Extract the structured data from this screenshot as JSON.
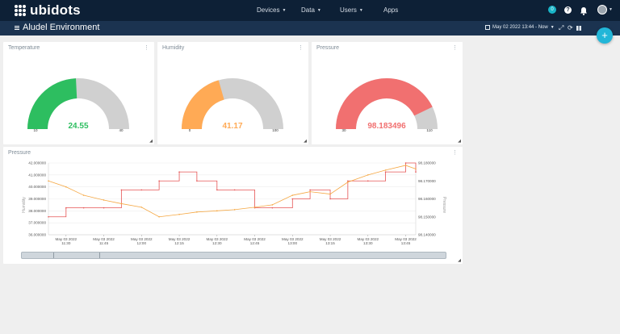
{
  "topbar": {
    "logo_text": "ubidots",
    "nav": [
      {
        "label": "Devices",
        "has_caret": true
      },
      {
        "label": "Data",
        "has_caret": true
      },
      {
        "label": "Users",
        "has_caret": true
      },
      {
        "label": "Apps",
        "has_caret": false
      }
    ],
    "badge_count": "0",
    "help_glyph": "?",
    "icons": [
      "bell-icon",
      "user-avatar"
    ]
  },
  "subbar": {
    "title": "Aludel Environment",
    "date_range": "May 02 2022 13:44 - Now",
    "icons": [
      "calendar-icon",
      "expand-icon",
      "refresh-icon",
      "columns-icon"
    ]
  },
  "fab_label": "+",
  "widgets": {
    "temperature": {
      "title": "Temperature",
      "value": "24.55",
      "min": "10",
      "max": "40",
      "fraction": 0.485,
      "color": "#2dbe60"
    },
    "humidity": {
      "title": "Humidity",
      "value": "41.17",
      "min": "0",
      "max": "100",
      "fraction": 0.4117,
      "color": "#ffaa55"
    },
    "pressure": {
      "title": "Pressure",
      "value": "98.183496",
      "min": "30",
      "max": "110",
      "fraction": 0.856,
      "color": "#f17070"
    }
  },
  "chart": {
    "title": "Pressure",
    "left_axis_label": "Humidity",
    "right_axis_label": "Pressure",
    "left_ticks": [
      "42.000000",
      "41.000000",
      "40.000000",
      "39.000000",
      "38.000000",
      "37.000000",
      "36.000000"
    ],
    "right_ticks": [
      "98.180000",
      "98.170000",
      "98.160000",
      "98.150000",
      "98.140000"
    ],
    "x_ticks": [
      {
        "date": "May 03 2022",
        "time": "11:30"
      },
      {
        "date": "May 03 2022",
        "time": "11:45"
      },
      {
        "date": "May 03 2022",
        "time": "12:00"
      },
      {
        "date": "May 03 2022",
        "time": "12:15"
      },
      {
        "date": "May 03 2022",
        "time": "12:30"
      },
      {
        "date": "May 03 2022",
        "time": "12:45"
      },
      {
        "date": "May 03 2022",
        "time": "13:00"
      },
      {
        "date": "May 03 2022",
        "time": "13:15"
      },
      {
        "date": "May 03 2022",
        "time": "13:30"
      },
      {
        "date": "May 03 2022",
        "time": "13:45"
      }
    ],
    "humidity_color": "#f5a742",
    "pressure_color": "#e55353"
  },
  "chart_data": {
    "type": "line",
    "title": "Pressure",
    "xlabel": "",
    "ylabel": "Humidity",
    "y2label": "Pressure",
    "ylim": [
      36,
      42
    ],
    "y2lim": [
      98.14,
      98.18
    ],
    "series": [
      {
        "name": "Humidity",
        "axis": "left",
        "x": [
          "11:23",
          "11:30",
          "11:37",
          "11:45",
          "11:52",
          "12:00",
          "12:07",
          "12:15",
          "12:22",
          "12:30",
          "12:37",
          "12:45",
          "12:52",
          "13:00",
          "13:07",
          "13:15",
          "13:22",
          "13:30",
          "13:37",
          "13:45",
          "13:49"
        ],
        "values": [
          40.5,
          40.0,
          39.3,
          38.9,
          38.6,
          38.3,
          37.5,
          37.7,
          37.9,
          38.0,
          38.1,
          38.3,
          38.5,
          39.3,
          39.6,
          39.4,
          40.4,
          41.0,
          41.4,
          41.8,
          41.5
        ]
      },
      {
        "name": "Pressure",
        "axis": "right",
        "x": [
          "11:23",
          "11:30",
          "11:37",
          "11:45",
          "11:52",
          "12:00",
          "12:07",
          "12:15",
          "12:22",
          "12:30",
          "12:37",
          "12:45",
          "12:52",
          "13:00",
          "13:07",
          "13:15",
          "13:22",
          "13:30",
          "13:37",
          "13:45",
          "13:49"
        ],
        "values": [
          98.15,
          98.155,
          98.155,
          98.155,
          98.165,
          98.165,
          98.17,
          98.175,
          98.17,
          98.165,
          98.165,
          98.155,
          98.155,
          98.16,
          98.165,
          98.16,
          98.17,
          98.17,
          98.175,
          98.18,
          98.175
        ]
      }
    ]
  }
}
